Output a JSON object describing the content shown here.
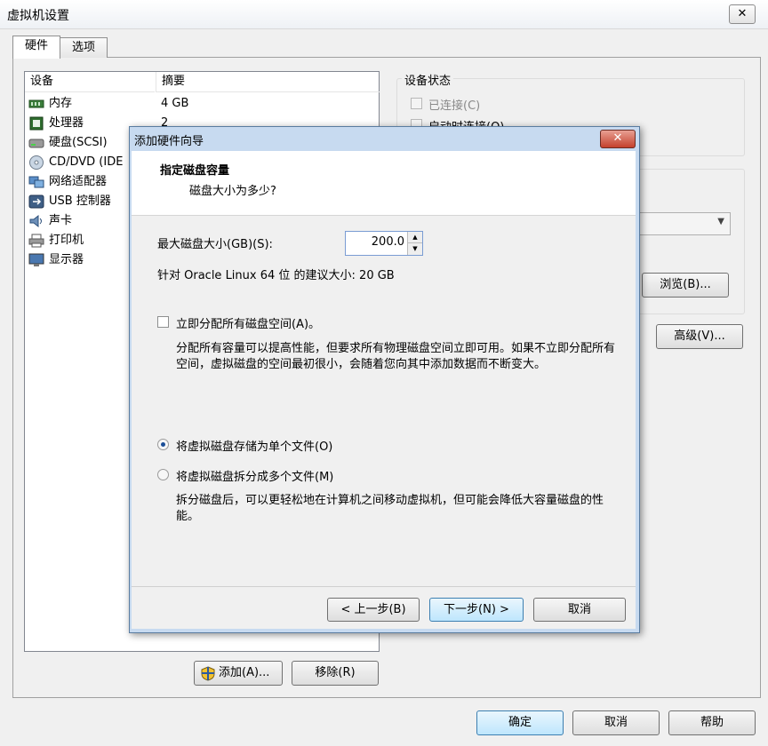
{
  "window": {
    "title": "虚拟机设置",
    "close_glyph": "✕",
    "tabs": [
      {
        "label": "硬件"
      },
      {
        "label": "选项"
      }
    ]
  },
  "device_list": {
    "col_device": "设备",
    "col_summary": "摘要",
    "rows": [
      {
        "name": "内存",
        "summary": "4 GB",
        "icon": "memory-icon"
      },
      {
        "name": "处理器",
        "summary": "2",
        "icon": "processor-icon"
      },
      {
        "name": "硬盘(SCSI)",
        "summary": "",
        "icon": "hard-disk-icon"
      },
      {
        "name": "CD/DVD (IDE",
        "summary": "",
        "icon": "cd-dvd-icon"
      },
      {
        "name": "网络适配器",
        "summary": "",
        "icon": "network-adapter-icon"
      },
      {
        "name": "USB 控制器",
        "summary": "",
        "icon": "usb-icon"
      },
      {
        "name": "声卡",
        "summary": "",
        "icon": "sound-card-icon"
      },
      {
        "name": "打印机",
        "summary": "",
        "icon": "printer-icon"
      },
      {
        "name": "显示器",
        "summary": "",
        "icon": "display-icon"
      }
    ]
  },
  "device_status": {
    "label": "设备状态",
    "connected": "已连接(C)",
    "connect_on_power_partial": "启动时连接(O)"
  },
  "right_panel": {
    "browse_button": "浏览(B)...",
    "advanced_button": "高级(V)..."
  },
  "list_buttons": {
    "add": "添加(A)...",
    "remove": "移除(R)"
  },
  "footer_buttons": {
    "ok": "确定",
    "cancel": "取消",
    "help": "帮助"
  },
  "wizard": {
    "title": "添加硬件向导",
    "heading": "指定磁盘容量",
    "subheading": "磁盘大小为多少?",
    "max_size_label": "最大磁盘大小(GB)(S):",
    "max_size_value": "200.0",
    "recommended": "针对 Oracle Linux 64 位 的建议大小: 20 GB",
    "allocate_now_label": "立即分配所有磁盘空间(A)。",
    "allocate_now_checked": false,
    "allocate_desc": "分配所有容量可以提高性能，但要求所有物理磁盘空间立即可用。如果不立即分配所有空间，虚拟磁盘的空间最初很小，会随着您向其中添加数据而不断变大。",
    "single_file_label": "将虚拟磁盘存储为单个文件(O)",
    "single_file_selected": true,
    "split_files_label": "将虚拟磁盘拆分成多个文件(M)",
    "split_desc": "拆分磁盘后，可以更轻松地在计算机之间移动虚拟机，但可能会降低大容量磁盘的性能。",
    "back_button": "< 上一步(B)",
    "next_button": "下一步(N) >",
    "cancel_button": "取消"
  }
}
